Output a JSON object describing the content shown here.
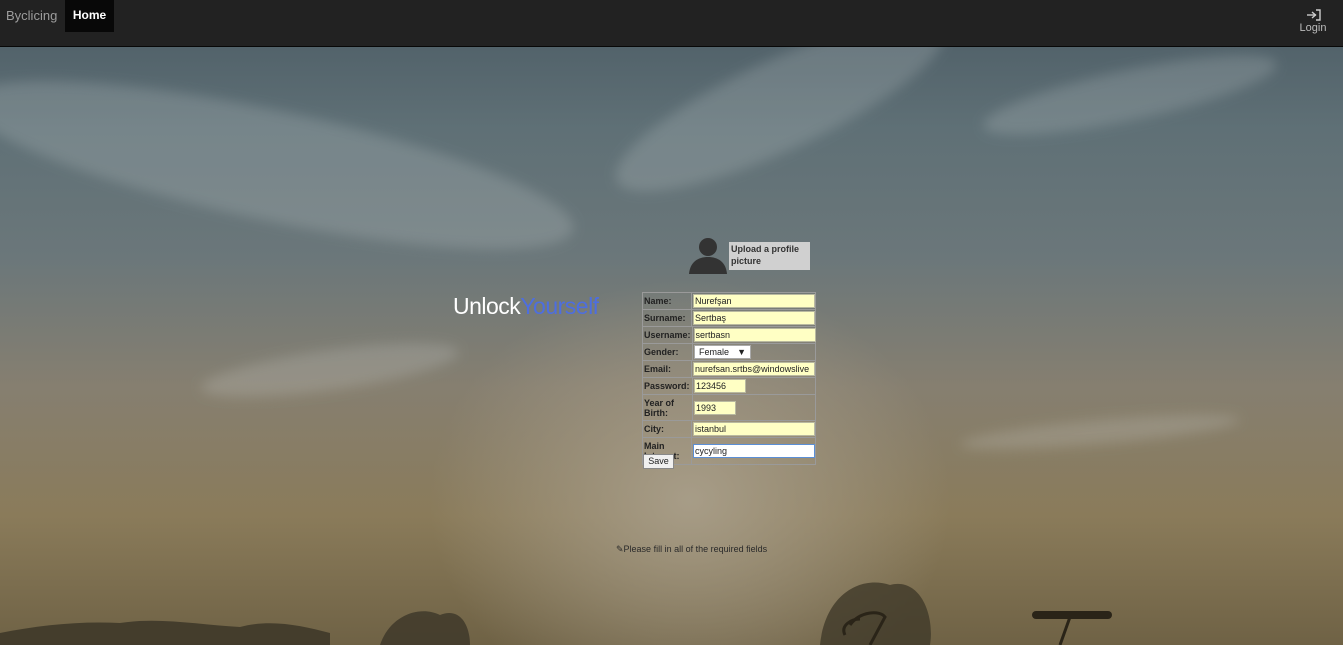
{
  "navbar": {
    "brand": "Byclicing",
    "home_label": "Home",
    "login_label": "Login",
    "login_icon": "login-icon"
  },
  "hero": {
    "title_part1": "Unlock",
    "title_part2": "Yourself",
    "accent_color": "#4d6ee0"
  },
  "profile": {
    "avatar_icon": "user-silhouette-icon",
    "upload_label": "Upload a profile picture"
  },
  "form": {
    "fields": [
      {
        "label": "Name:",
        "value": "Nurefşan"
      },
      {
        "label": "Surname:",
        "value": "Sertbaş"
      },
      {
        "label": "Username:",
        "value": "sertbasn"
      },
      {
        "label": "Gender:",
        "value": "Female"
      },
      {
        "label": "Email:",
        "value": "nurefsan.srtbs@windowslive"
      },
      {
        "label": "Password:",
        "value": "123456"
      },
      {
        "label": "Year of Birth:",
        "value": "1993"
      },
      {
        "label": "City:",
        "value": "istanbul"
      },
      {
        "label": "Main Interest:",
        "value": "cycyling"
      }
    ],
    "save_label": "Save",
    "hint": "Please fill in all of the required fields",
    "hint_icon": "pencil-icon"
  }
}
